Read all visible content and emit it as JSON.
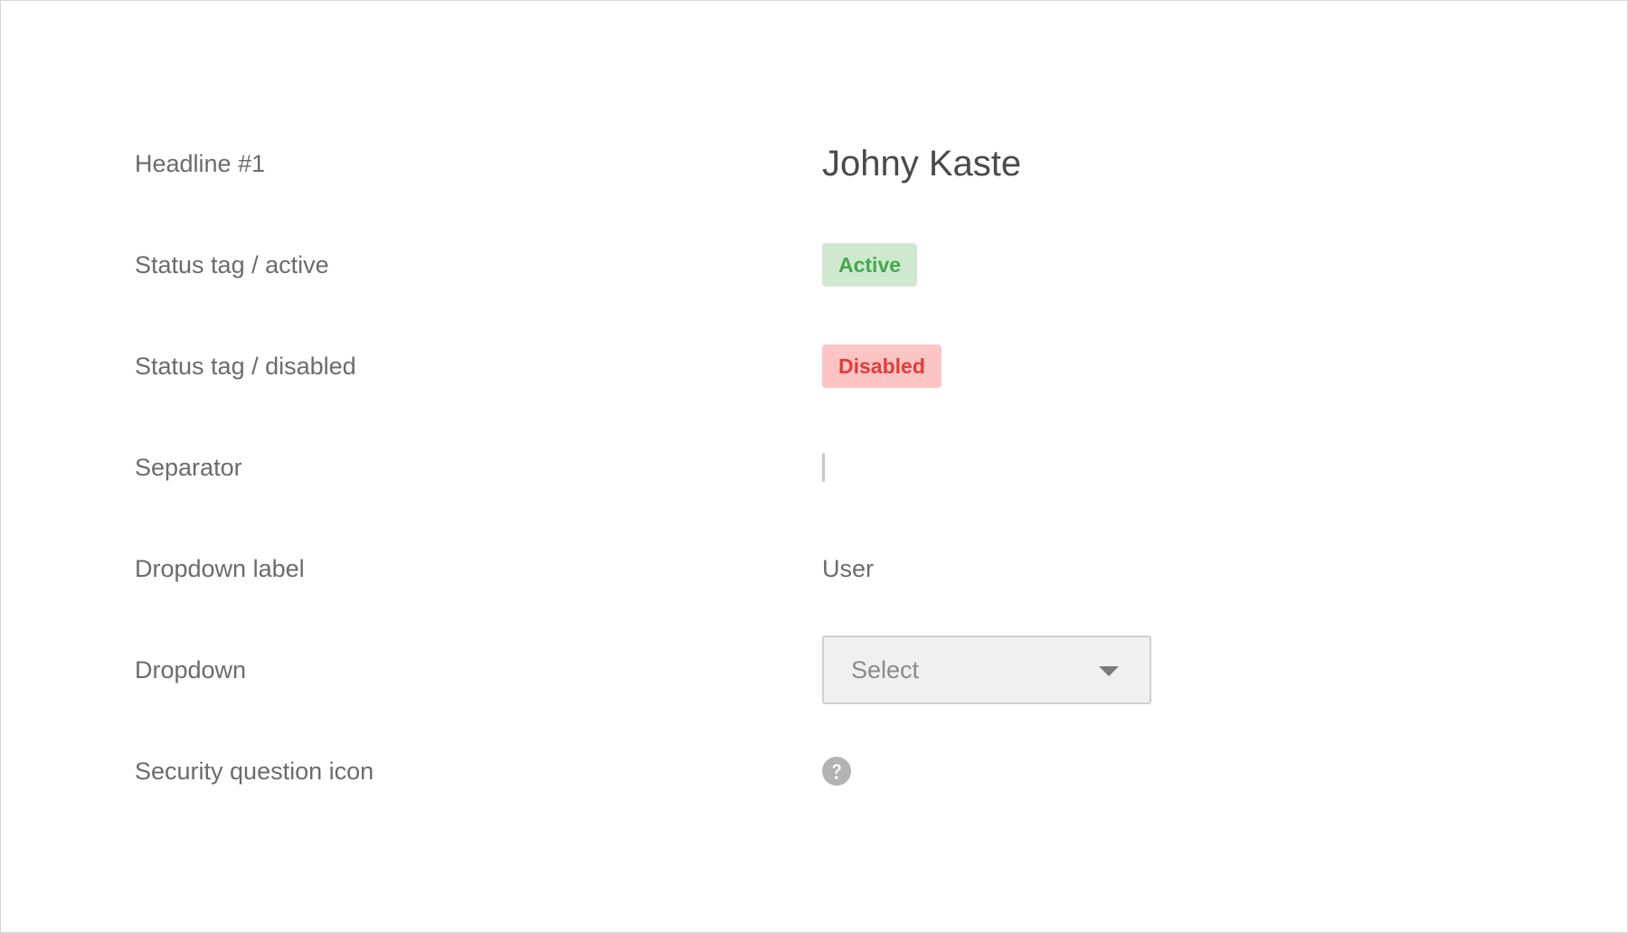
{
  "rows": [
    {
      "label": "Headline #1",
      "value": "Johny Kaste"
    },
    {
      "label": "Status tag / active",
      "value": "Active"
    },
    {
      "label": "Status tag / disabled",
      "value": "Disabled"
    },
    {
      "label": "Separator"
    },
    {
      "label": "Dropdown label",
      "value": "User"
    },
    {
      "label": "Dropdown",
      "value": "Select"
    },
    {
      "label": "Security question icon",
      "icon": "question-circle-icon"
    }
  ],
  "colors": {
    "active_bg": "#cfe9d1",
    "active_text": "#43a849",
    "disabled_bg": "#fcc5c4",
    "disabled_text": "#e23c39",
    "label_text": "#6b6b6b",
    "icon": "#b3b3b3"
  }
}
